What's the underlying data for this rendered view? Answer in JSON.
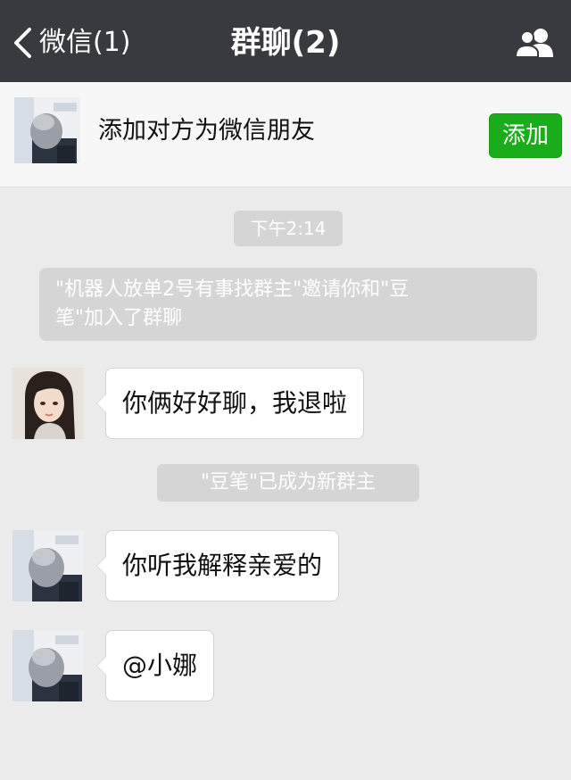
{
  "header": {
    "back_label": "微信(1)",
    "title": "群聊(2)",
    "back_icon": "chevron-left-icon",
    "group_icon": "group-members-icon"
  },
  "banner": {
    "text": "添加对方为微信朋友",
    "button_label": "添加"
  },
  "chat": {
    "time": "下午2:14",
    "system_invite_line1": "\"机器人放单2号有事找群主\"邀请你和\"豆",
    "system_invite_line2": "笔\"加入了群聊",
    "system_owner": "\"豆笔\"已成为新群主",
    "messages": [
      {
        "text": "你俩好好聊，我退啦"
      },
      {
        "text": "你听我解释亲爱的"
      },
      {
        "text": "@小娜"
      }
    ]
  },
  "colors": {
    "header_bg": "#393a3f",
    "chat_bg": "#ebebeb",
    "add_button": "#1aad19",
    "system_pill": "#d5d5d5"
  }
}
